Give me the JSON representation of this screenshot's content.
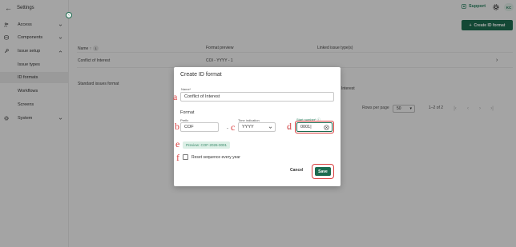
{
  "sidebar": {
    "title": "Settings",
    "items": [
      {
        "label": "Access",
        "icon": "people-icon"
      },
      {
        "label": "Components",
        "icon": "stack-icon"
      },
      {
        "label": "Issue setup",
        "icon": "wrench-icon"
      },
      {
        "label": "Issue types"
      },
      {
        "label": "ID formats"
      },
      {
        "label": "Workflows"
      },
      {
        "label": "Screens"
      },
      {
        "label": "System",
        "icon": "gear-icon"
      }
    ]
  },
  "topbar": {
    "support_label": "Support",
    "avatar_initials": "KC"
  },
  "main": {
    "create_button_label": "Create ID format",
    "table": {
      "columns": [
        "Name",
        "Format preview",
        "Linked issue type(s)"
      ],
      "sort_count": "1",
      "rows": [
        {
          "name": "Conflict of Interest",
          "format": "COI - YYYY - 1",
          "linked": ""
        },
        {
          "name": "Standard issues format",
          "format": "",
          "linked": "Interest"
        }
      ]
    },
    "pagination": {
      "rows_per_page_label": "Rows per page",
      "rows_per_page_value": "50",
      "range": "1–2 of 2"
    }
  },
  "modal": {
    "title": "Create ID format",
    "name_label": "Name*",
    "name_value": "Conflict of Interest",
    "format_title": "Format",
    "prefix_label": "Prefix",
    "prefix_value": "COF",
    "separator_1": "-",
    "time_label": "Time indication",
    "time_value": "YYYY",
    "separator_2": "-",
    "start_label": "Start number*",
    "start_value": "0001",
    "preview": "Preview: COF-2026-0001",
    "reset_label": "Reset sequence every year",
    "cancel_label": "Cancel",
    "save_label": "Save"
  },
  "annotations": [
    "a",
    "b",
    "c",
    "d",
    "e",
    "f"
  ],
  "colors": {
    "accent": "#1c6b4f",
    "annotation": "#d94040",
    "preview_bg": "#dcefe6"
  }
}
